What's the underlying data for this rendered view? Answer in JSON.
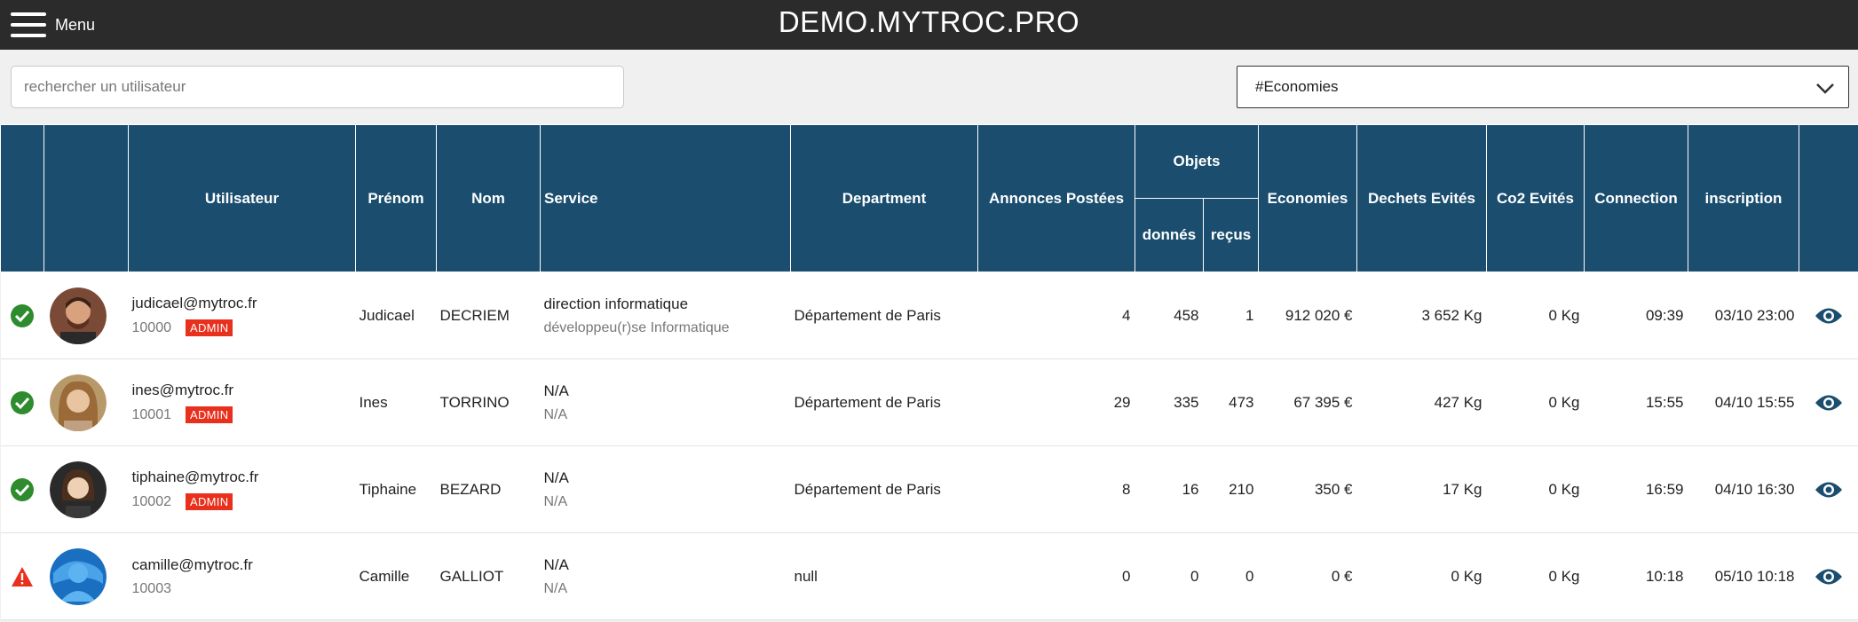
{
  "header": {
    "menu_label": "Menu",
    "title": "DEMO.MYTROC.PRO"
  },
  "search": {
    "placeholder": "rechercher un utilisateur",
    "value": ""
  },
  "filter": {
    "selected": "#Economies"
  },
  "table": {
    "columns": {
      "utilisateur": "Utilisateur",
      "prenom": "Prénom",
      "nom": "Nom",
      "service": "Service",
      "department": "Department",
      "annonces": "Annonces Postées",
      "objets": "Objets",
      "donnes": "donnés",
      "recus": "reçus",
      "economies": "Economies",
      "dechets": "Dechets Evités",
      "co2": "Co2 Evités",
      "connection": "Connection",
      "inscription": "inscription"
    },
    "rows": [
      {
        "status": "ok",
        "email": "judicael@mytroc.fr",
        "id": "10000",
        "badge": "ADMIN",
        "prenom": "Judicael",
        "nom": "DECRIEM",
        "service": "direction informatique",
        "service_sub": "développeu(r)se Informatique",
        "department": "Département de Paris",
        "annonces": "4",
        "donnes": "458",
        "recus": "1",
        "economies": "912 020 €",
        "dechets": "3 652 Kg",
        "co2": "0 Kg",
        "connection": "09:39",
        "inscription": "03/10 23:00"
      },
      {
        "status": "ok",
        "email": "ines@mytroc.fr",
        "id": "10001",
        "badge": "ADMIN",
        "prenom": "Ines",
        "nom": "TORRINO",
        "service": "N/A",
        "service_sub": "N/A",
        "department": "Département de Paris",
        "annonces": "29",
        "donnes": "335",
        "recus": "473",
        "economies": "67 395 €",
        "dechets": "427 Kg",
        "co2": "0 Kg",
        "connection": "15:55",
        "inscription": "04/10 15:55"
      },
      {
        "status": "ok",
        "email": "tiphaine@mytroc.fr",
        "id": "10002",
        "badge": "ADMIN",
        "prenom": "Tiphaine",
        "nom": "BEZARD",
        "service": "N/A",
        "service_sub": "N/A",
        "department": "Département de Paris",
        "annonces": "8",
        "donnes": "16",
        "recus": "210",
        "economies": "350 €",
        "dechets": "17 Kg",
        "co2": "0 Kg",
        "connection": "16:59",
        "inscription": "04/10 16:30"
      },
      {
        "status": "warning",
        "email": "camille@mytroc.fr",
        "id": "10003",
        "badge": "",
        "prenom": "Camille",
        "nom": "GALLIOT",
        "service": "N/A",
        "service_sub": "N/A",
        "department": "null",
        "annonces": "0",
        "donnes": "0",
        "recus": "0",
        "economies": "0 €",
        "dechets": "0 Kg",
        "co2": "0 Kg",
        "connection": "10:18",
        "inscription": "05/10 10:18"
      }
    ]
  },
  "colors": {
    "header_bg": "#1a4d6e",
    "topbar_bg": "#2b2b2b",
    "ok": "#2e8b2e",
    "warning": "#e8301c",
    "badge": "#e8301c",
    "eye": "#1a4d6e"
  }
}
